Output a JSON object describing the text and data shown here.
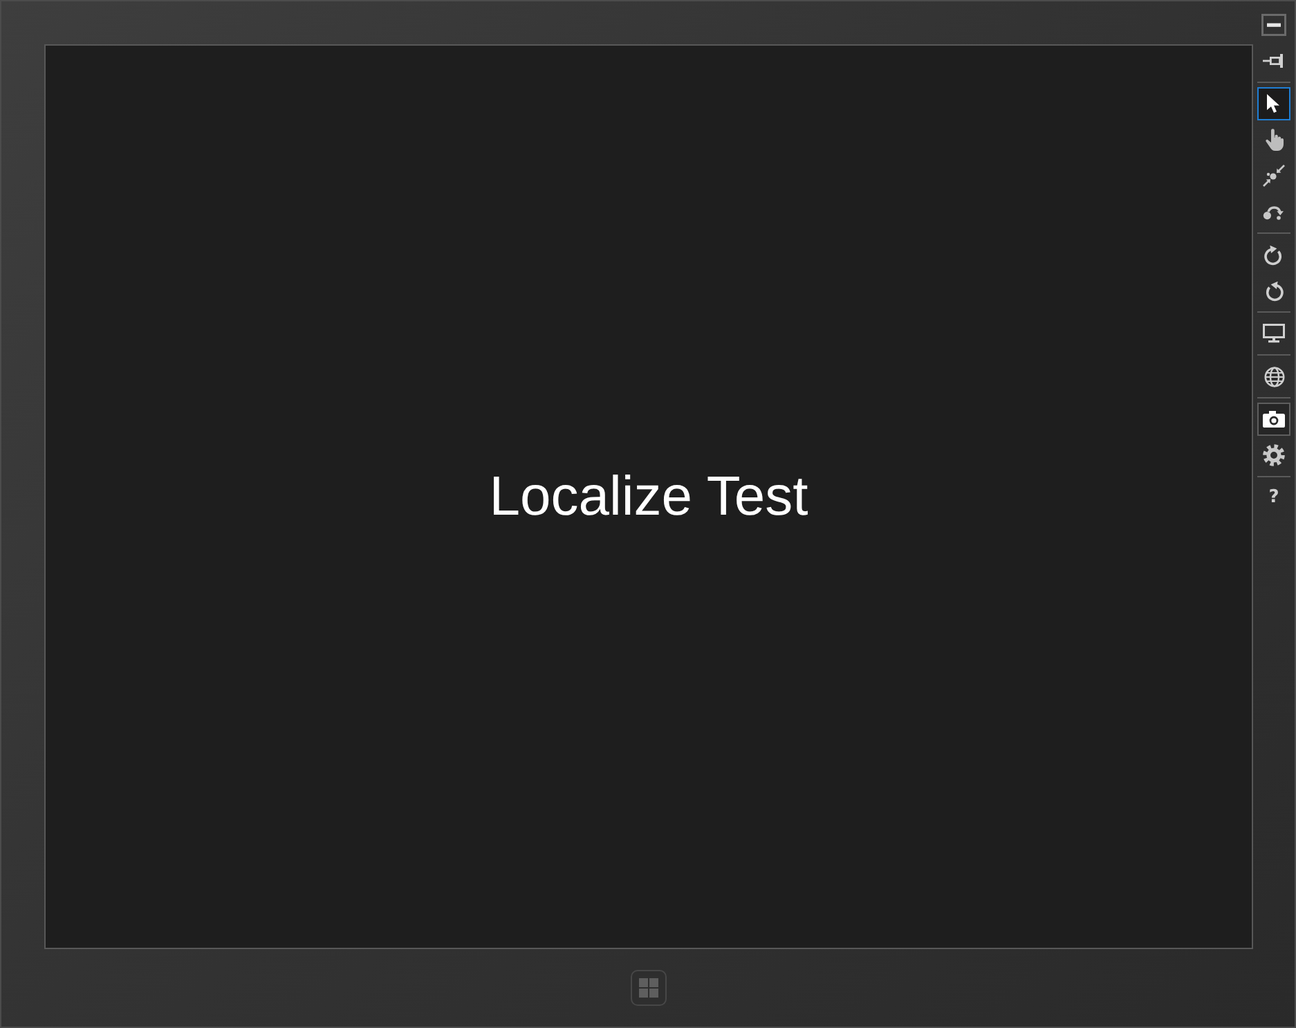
{
  "screen": {
    "title": "Localize Test"
  },
  "toolbar": [
    {
      "items": [
        {
          "kind": "minimize",
          "selected": false,
          "hovered": false
        },
        {
          "kind": "pin",
          "selected": false,
          "hovered": false
        }
      ]
    },
    {
      "items": [
        {
          "kind": "mouse",
          "selected": true,
          "hovered": false
        },
        {
          "kind": "touch",
          "selected": false,
          "hovered": false
        },
        {
          "kind": "pinch",
          "selected": false,
          "hovered": false
        },
        {
          "kind": "rotation",
          "selected": false,
          "hovered": false
        }
      ]
    },
    {
      "items": [
        {
          "kind": "rotate_cw",
          "selected": false,
          "hovered": false
        },
        {
          "kind": "rotate_ccw",
          "selected": false,
          "hovered": false
        }
      ]
    },
    {
      "items": [
        {
          "kind": "resolution",
          "selected": false,
          "hovered": false
        }
      ]
    },
    {
      "items": [
        {
          "kind": "location",
          "selected": false,
          "hovered": false
        }
      ]
    },
    {
      "items": [
        {
          "kind": "screenshot",
          "selected": false,
          "hovered": true
        },
        {
          "kind": "settings",
          "selected": false,
          "hovered": false
        }
      ]
    },
    {
      "items": [
        {
          "kind": "help",
          "label": "?",
          "selected": false,
          "hovered": false
        }
      ]
    }
  ]
}
